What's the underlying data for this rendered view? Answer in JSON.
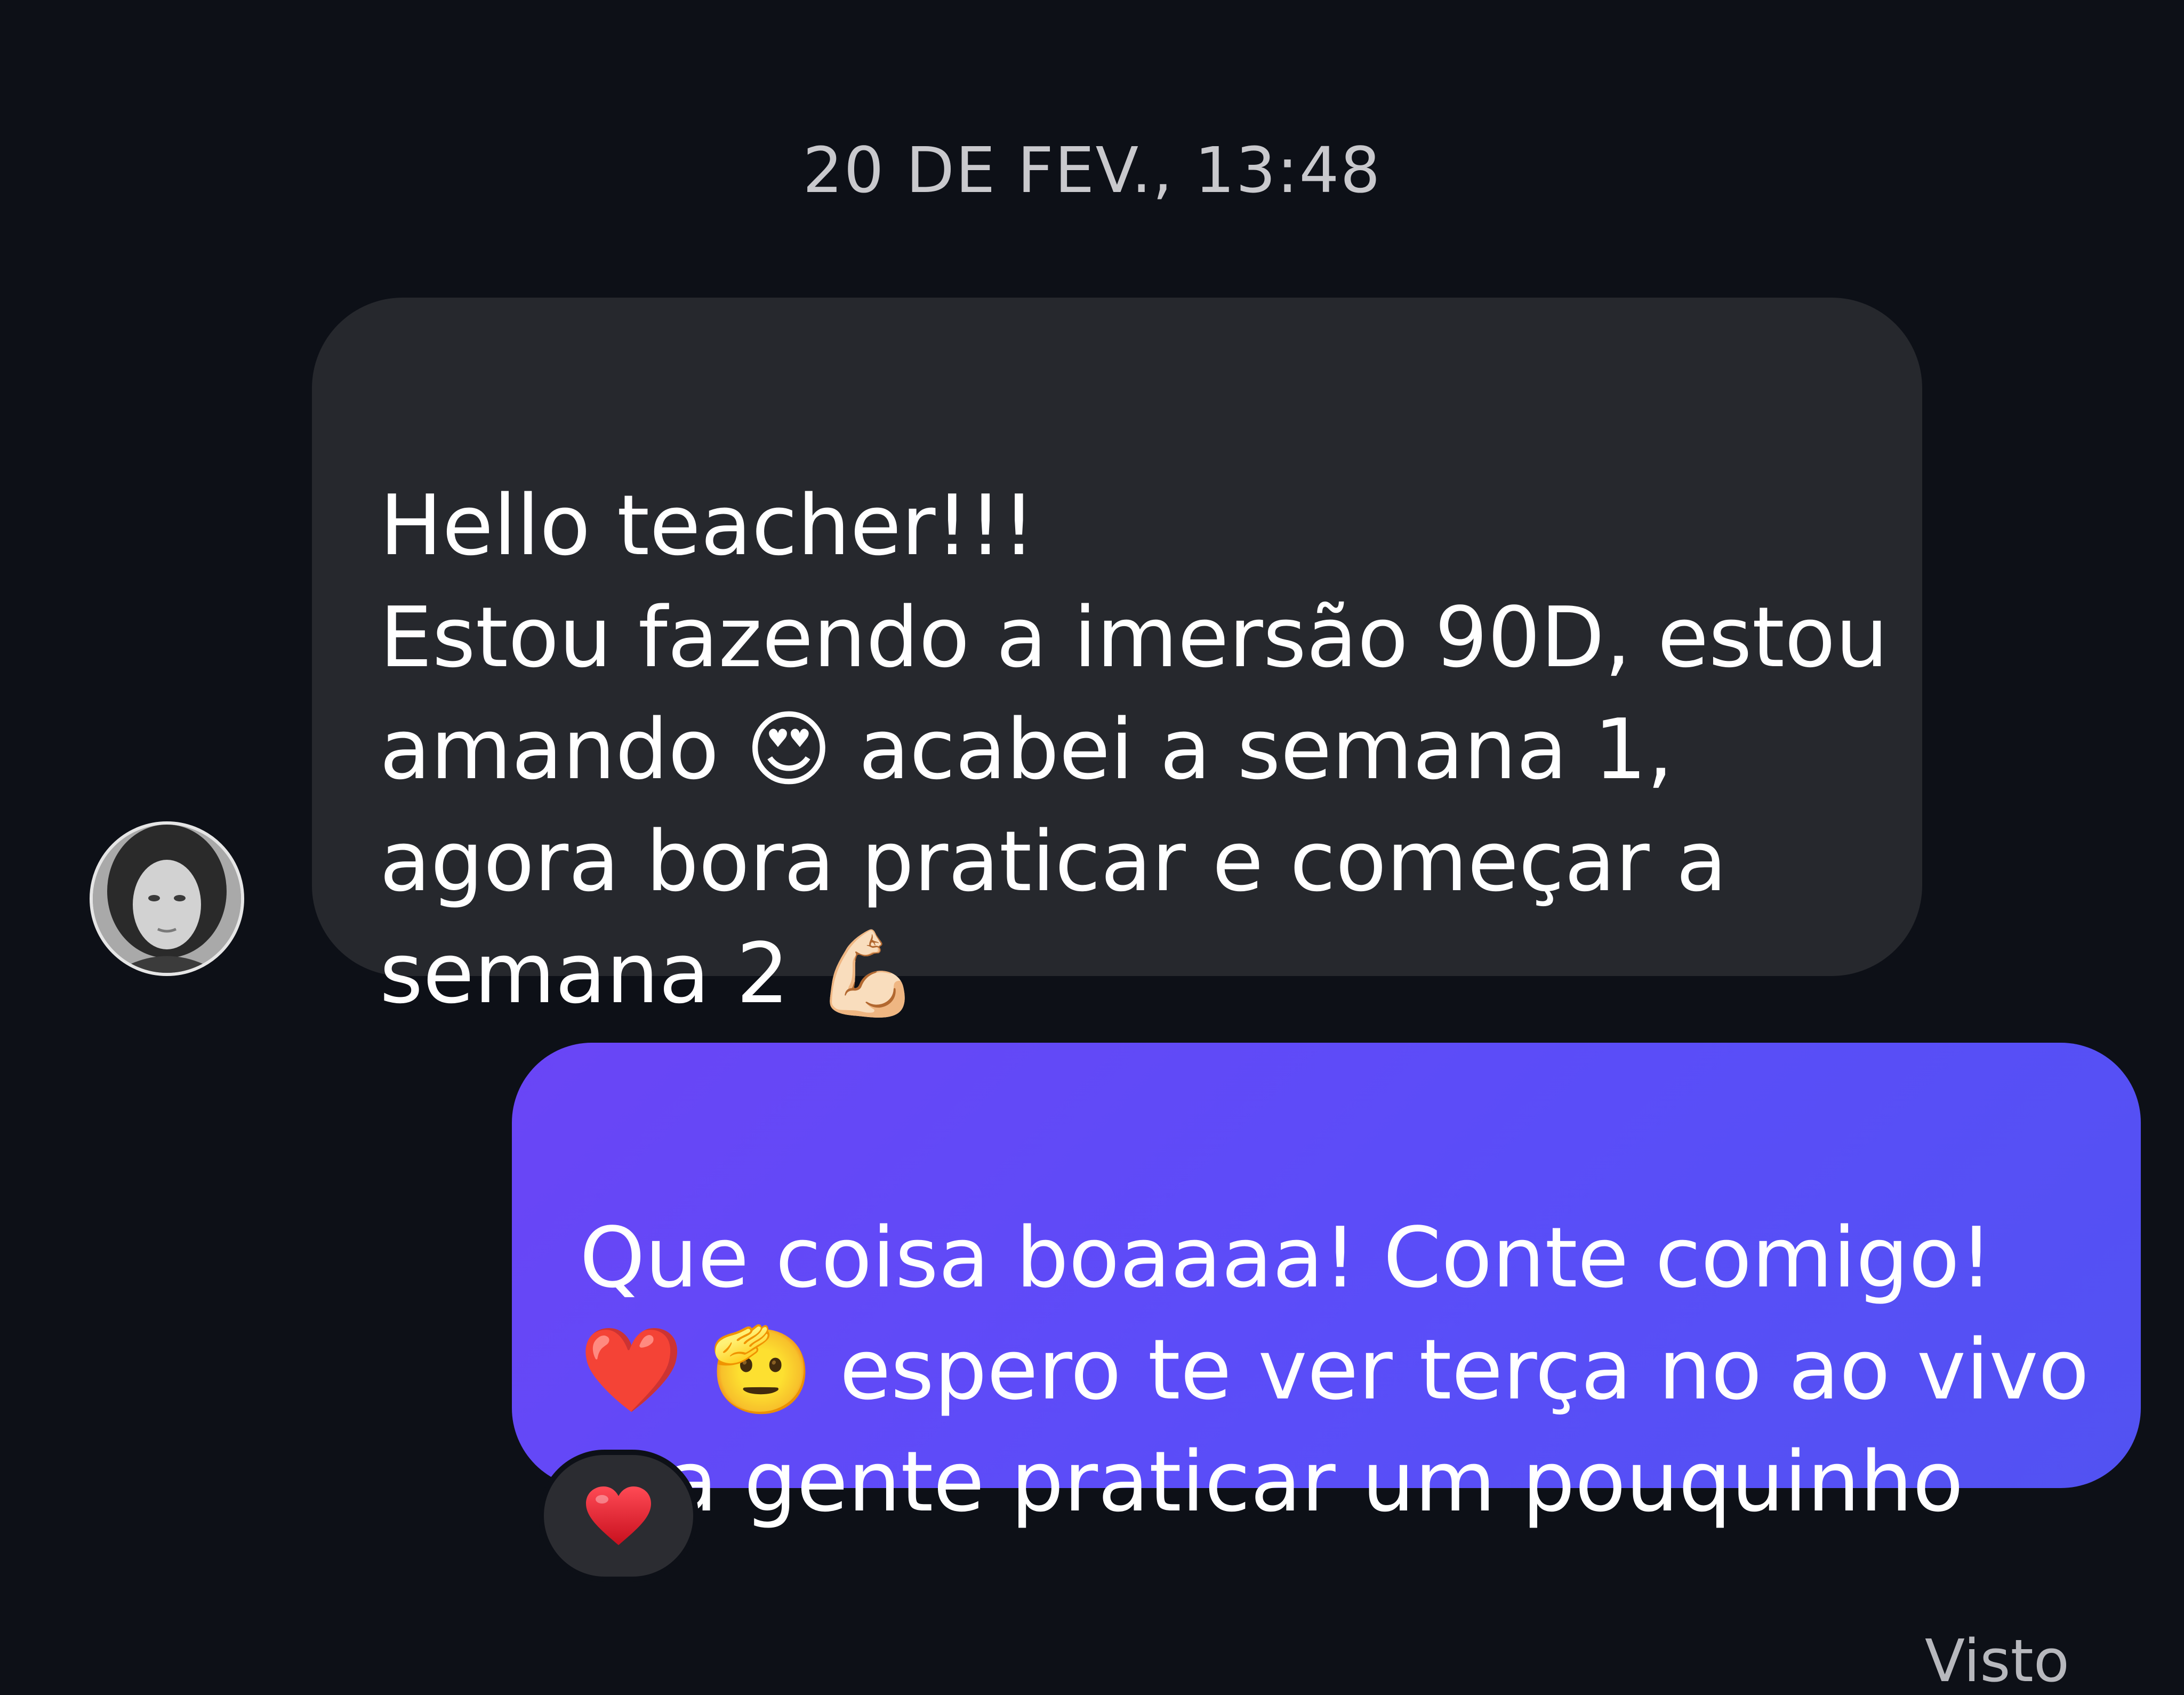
{
  "conversation": {
    "timestamp": "20 DE FEV., 13:48",
    "messages": [
      {
        "direction": "received",
        "text": "Hello teacher!!!\nEstou fazendo a imersão 90D, estou amando 😍 acabei a semana 1, agora bora praticar e começar a semana 2 💪🏻"
      },
      {
        "direction": "sent",
        "text": "Que coisa boaaaa! Conte comigo!\n❤️ 🫡 espero te ver terça no ao vivo pra gente praticar um pouquinho",
        "reaction": "heart-icon"
      }
    ],
    "status": "Visto"
  },
  "colors": {
    "background": "#0d1017",
    "received_bubble": "#26282d",
    "sent_bubble": "#5a4df8",
    "reaction_heart": "#e0202c"
  }
}
